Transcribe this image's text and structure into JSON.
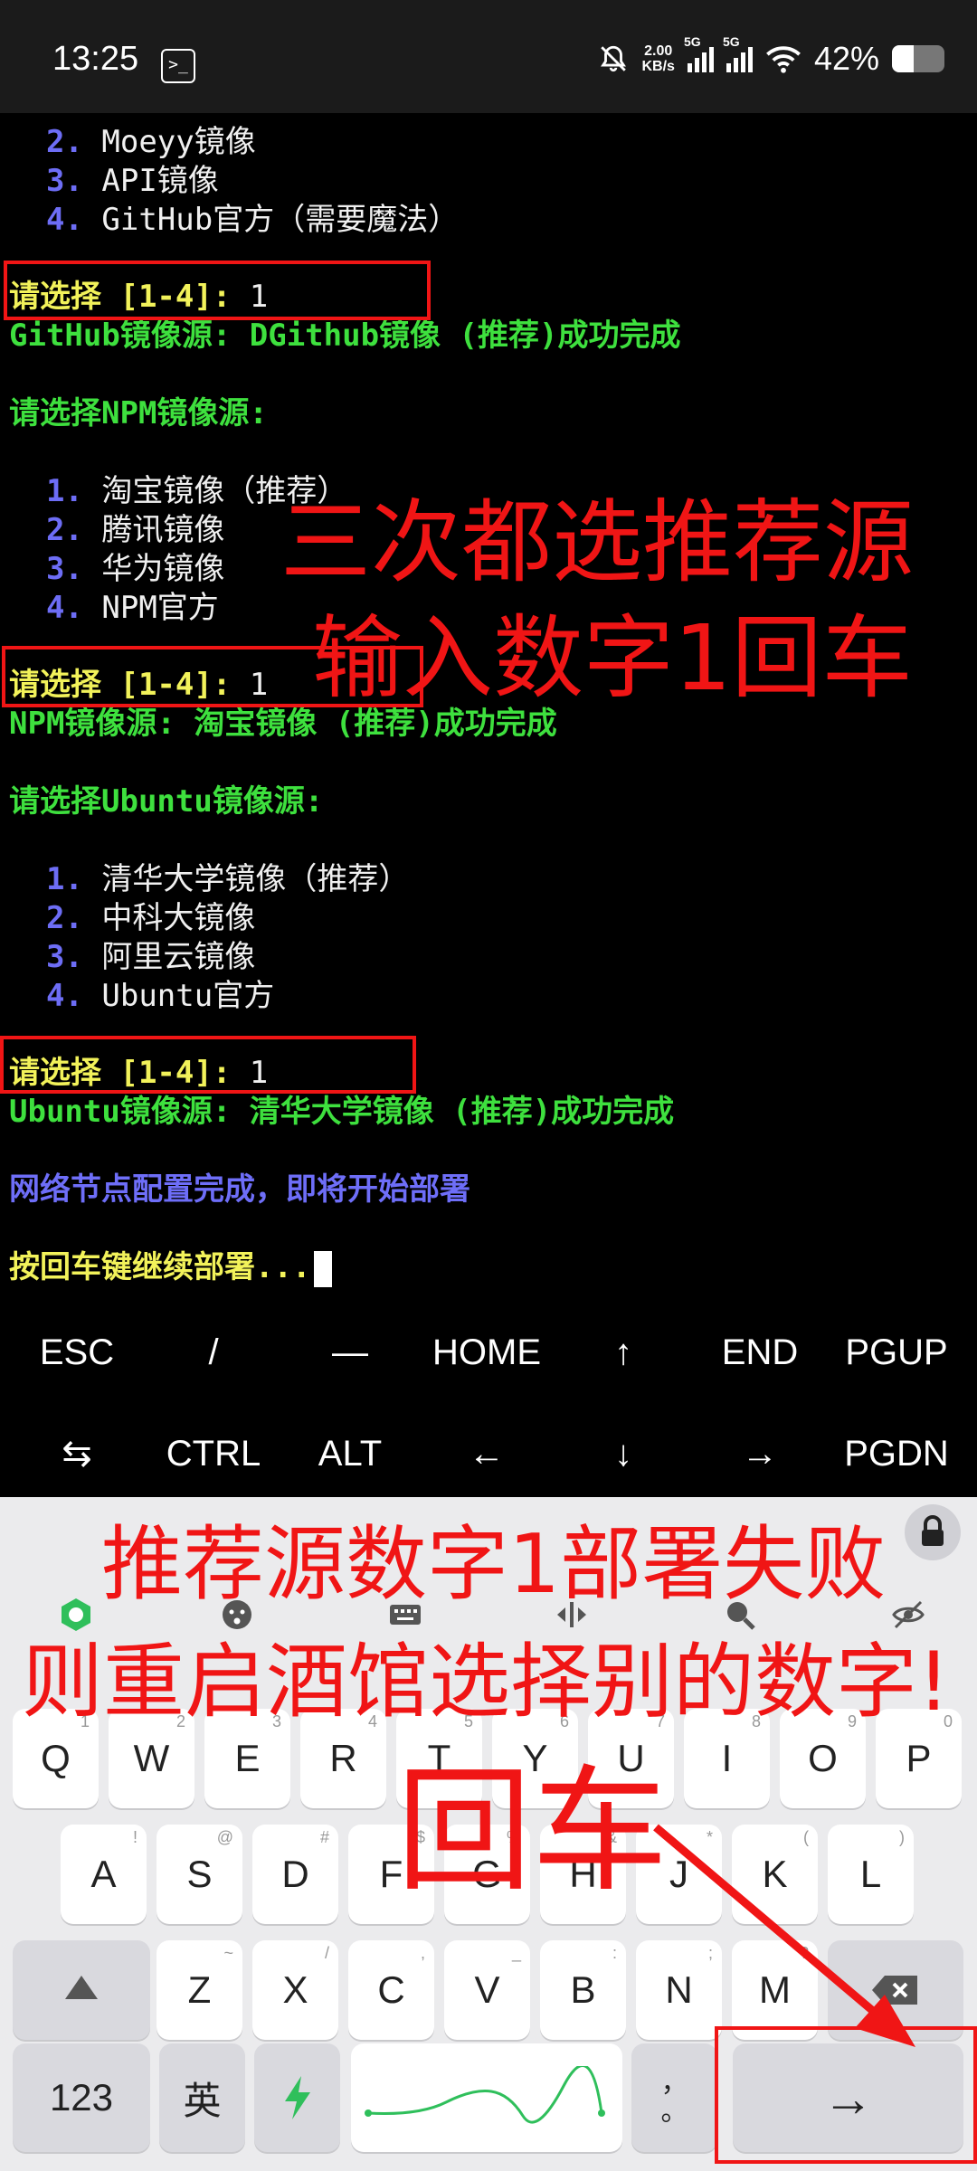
{
  "status_bar": {
    "time": "13:25",
    "terminal_badge": ">_",
    "speed_value": "2.00",
    "speed_unit": "KB/s",
    "net1": "5G",
    "net2": "5G",
    "battery_text": "42%",
    "battery_level": 0.42
  },
  "terminal": {
    "lines": [
      {
        "num": "2.",
        "text": "Moeyy镜像"
      },
      {
        "num": "3.",
        "text": "API镜像"
      },
      {
        "num": "4.",
        "text": "GitHub官方（需要魔法）"
      },
      {
        "prompt": "请选择 [1-4]:",
        "input": " 1"
      },
      {
        "text": "GitHub镜像源: DGithub镜像 (推荐)成功完成"
      },
      {
        "text": "请选择NPM镜像源:"
      },
      {
        "num": "1.",
        "text": "淘宝镜像（推荐）"
      },
      {
        "num": "2.",
        "text": "腾讯镜像"
      },
      {
        "num": "3.",
        "text": "华为镜像"
      },
      {
        "num": "4.",
        "text": "NPM官方"
      },
      {
        "prompt": "请选择 [1-4]:",
        "input": " 1"
      },
      {
        "text": "NPM镜像源: 淘宝镜像 (推荐)成功完成"
      },
      {
        "text": "请选择Ubuntu镜像源:"
      },
      {
        "num": "1.",
        "text": "清华大学镜像（推荐）"
      },
      {
        "num": "2.",
        "text": "中科大镜像"
      },
      {
        "num": "3.",
        "text": "阿里云镜像"
      },
      {
        "num": "4.",
        "text": "Ubuntu官方"
      },
      {
        "prompt": "请选择 [1-4]:",
        "input": " 1"
      },
      {
        "text": "Ubuntu镜像源: 清华大学镜像 (推荐)成功完成"
      },
      {
        "text": "网络节点配置完成，即将开始部署"
      },
      {
        "text": "按回车键继续部署..."
      }
    ]
  },
  "annotations": {
    "line1": "三次都选推荐源",
    "line2": "输入数字1回车",
    "line3": "推荐源数字1部署失败",
    "line4": "则重启酒馆选择别的数字!",
    "line5": "回车"
  },
  "extra_keys": {
    "row1": [
      "ESC",
      "/",
      "—",
      "HOME",
      "↑",
      "END",
      "PGUP"
    ],
    "row2": [
      "⇆",
      "CTRL",
      "ALT",
      "←",
      "↓",
      "→",
      "PGDN"
    ]
  },
  "keyboard": {
    "row1": [
      {
        "k": "Q",
        "s": "1"
      },
      {
        "k": "W",
        "s": "2"
      },
      {
        "k": "E",
        "s": "3"
      },
      {
        "k": "R",
        "s": "4"
      },
      {
        "k": "T",
        "s": "5"
      },
      {
        "k": "Y",
        "s": "6"
      },
      {
        "k": "U",
        "s": "7"
      },
      {
        "k": "I",
        "s": "8"
      },
      {
        "k": "O",
        "s": "9"
      },
      {
        "k": "P",
        "s": "0"
      }
    ],
    "row2": [
      {
        "k": "A",
        "s": "!"
      },
      {
        "k": "S",
        "s": "@"
      },
      {
        "k": "D",
        "s": "#"
      },
      {
        "k": "F",
        "s": "$"
      },
      {
        "k": "G",
        "s": "%"
      },
      {
        "k": "H",
        "s": "&"
      },
      {
        "k": "J",
        "s": "*"
      },
      {
        "k": "K",
        "s": "("
      },
      {
        "k": "L",
        "s": ")"
      }
    ],
    "row3": [
      {
        "k": "Z",
        "s": "~"
      },
      {
        "k": "X",
        "s": "/"
      },
      {
        "k": "C",
        "s": ","
      },
      {
        "k": "V",
        "s": "_"
      },
      {
        "k": "B",
        "s": ":"
      },
      {
        "k": "N",
        "s": ";"
      },
      {
        "k": "M",
        "s": "?"
      }
    ],
    "num_key": "123",
    "lang_key": "英",
    "punct_key": "，\n。",
    "enter_key": "→"
  }
}
